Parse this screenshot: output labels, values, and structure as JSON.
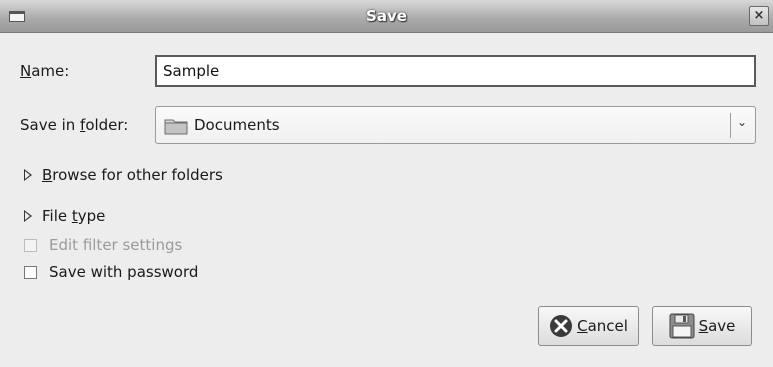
{
  "window": {
    "title": "Save",
    "close_glyph": "×"
  },
  "form": {
    "name_label_hotkey": "N",
    "name_label_rest": "ame:",
    "name_value": "Sample",
    "folder_label_pre": "Save in ",
    "folder_label_hotkey": "f",
    "folder_label_rest": "older:",
    "folder_value": "Documents",
    "folder_icon": "folder-icon",
    "dropdown_glyph": "⌄"
  },
  "expanders": {
    "browse_hotkey": "B",
    "browse_rest": "rowse for other folders",
    "filetype_pre": "File ",
    "filetype_hotkey": "t",
    "filetype_rest": "ype"
  },
  "options": {
    "edit_filter_label": "Edit filter settings",
    "edit_filter_checked": false,
    "edit_filter_enabled": false,
    "password_label": "Save with password",
    "password_checked": false
  },
  "buttons": {
    "cancel_hotkey": "C",
    "cancel_rest": "ancel",
    "cancel_icon": "cancel-icon",
    "save_hotkey": "S",
    "save_rest": "ave",
    "save_icon": "floppy-disk-icon"
  },
  "colors": {
    "titlebar": "#a9a9a9",
    "background": "#ededed",
    "disabled_text": "#9b9b9b"
  }
}
